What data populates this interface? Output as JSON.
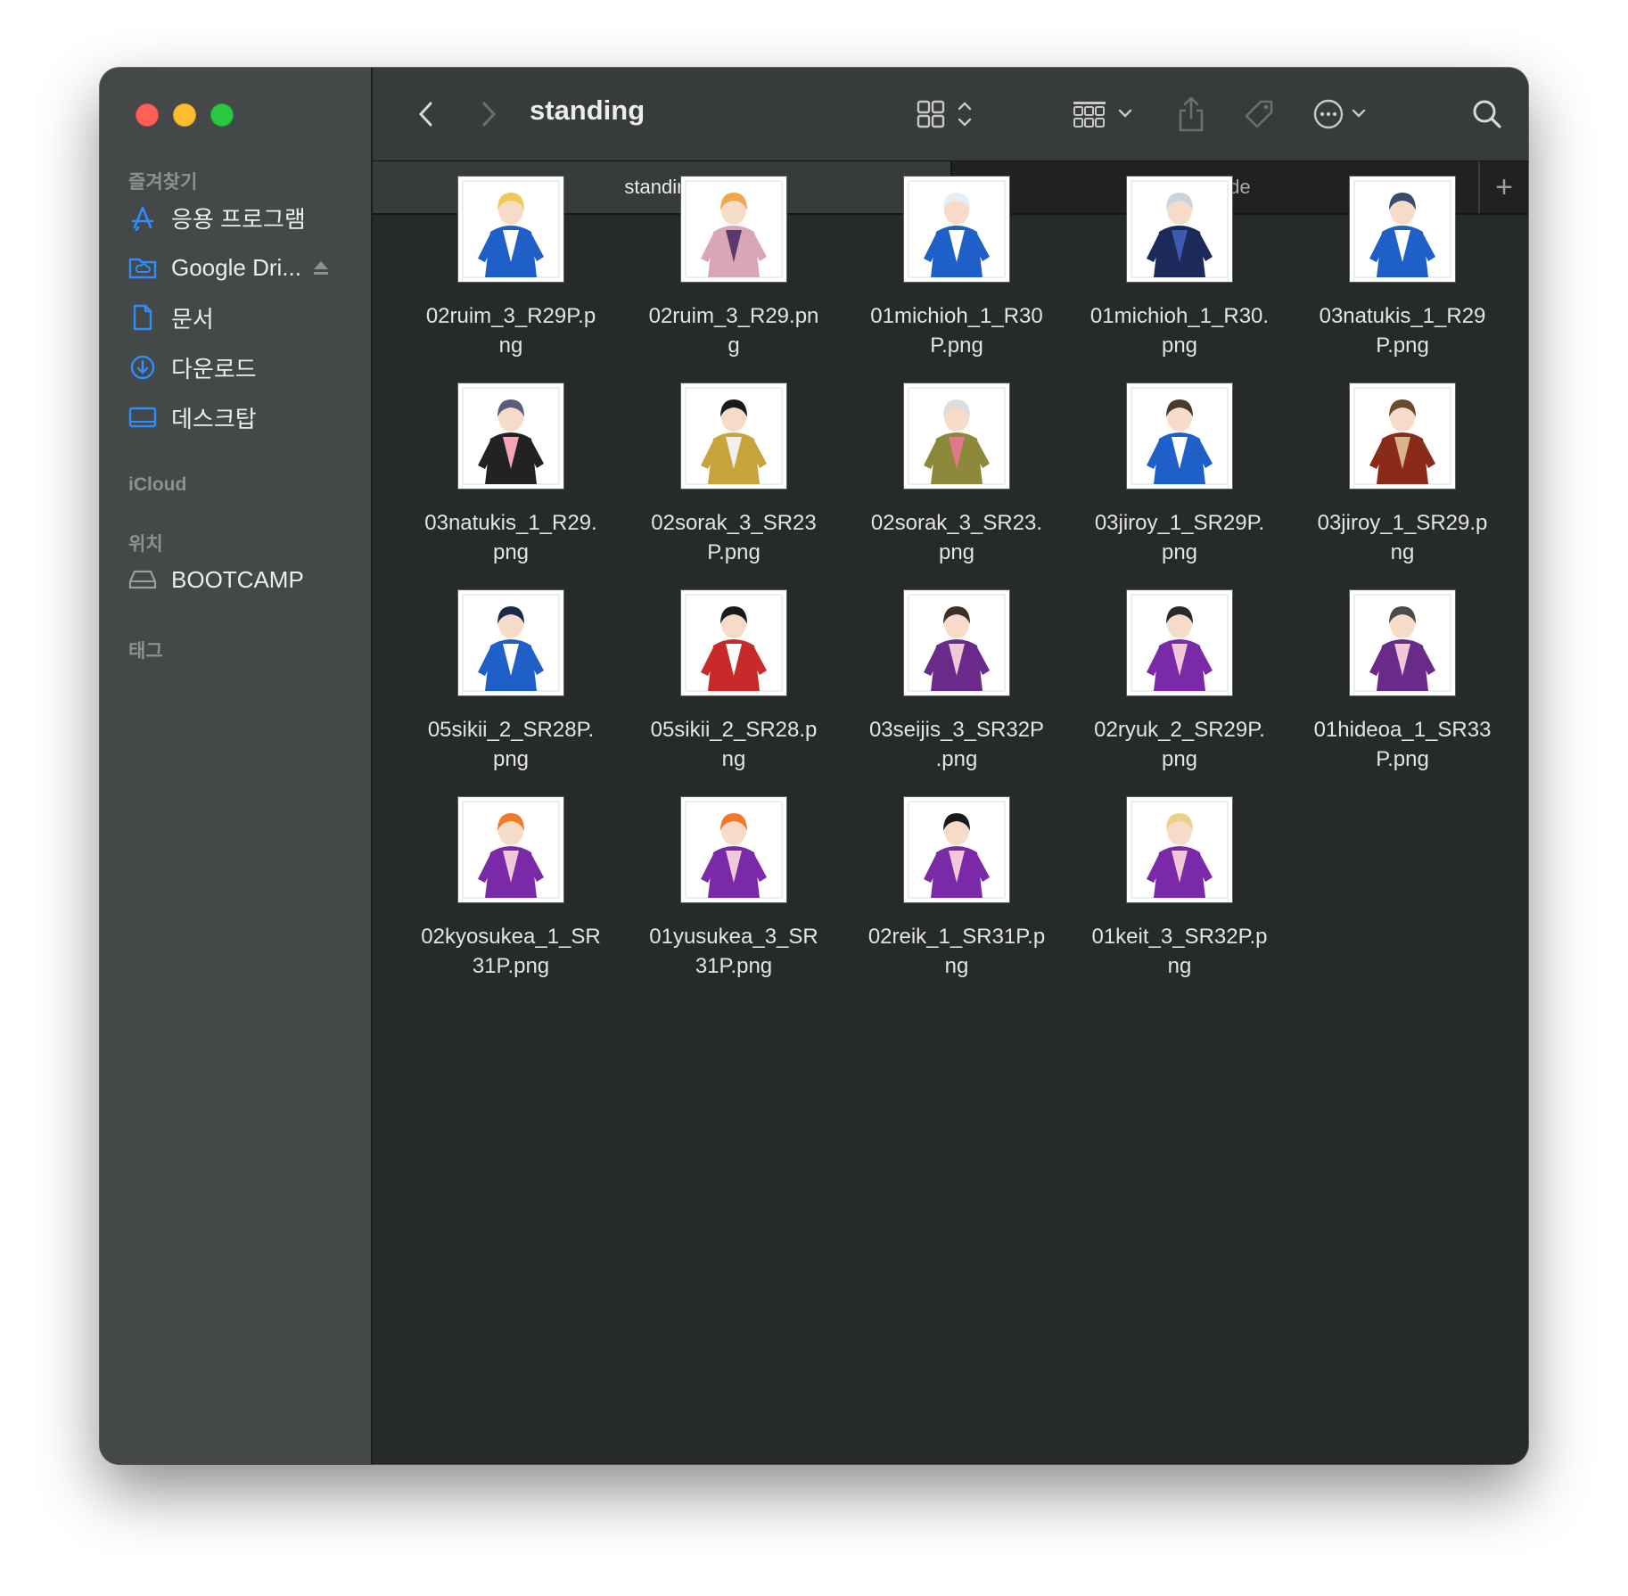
{
  "window": {
    "title": "standing",
    "tabs": [
      {
        "label": "standing",
        "active": true
      },
      {
        "label": "bromide",
        "active": false
      }
    ],
    "new_tab_label": "+"
  },
  "sidebar": {
    "sections": {
      "favorites": "즐겨찾기",
      "icloud": "iCloud",
      "locations": "위치",
      "tags": "태그"
    },
    "favorites": [
      {
        "label": "응용 프로그램",
        "icon": "applications-icon"
      },
      {
        "label": "Google Dri...",
        "icon": "cloud-folder-icon"
      },
      {
        "label": "문서",
        "icon": "document-icon"
      },
      {
        "label": "다운로드",
        "icon": "download-icon"
      },
      {
        "label": "데스크탑",
        "icon": "desktop-icon"
      }
    ],
    "locations": [
      {
        "label": "BOOTCAMP",
        "icon": "drive-icon"
      }
    ]
  },
  "colors": {
    "accent": "#2f8cff",
    "close": "#fe5f57",
    "minimize": "#febc2e",
    "zoom": "#28c840"
  },
  "files": [
    {
      "name_l1": "02ruim_3_R29P.p",
      "name_l2": "ng",
      "palette": {
        "outfit": "#1f5fc8",
        "hair": "#f2c75a",
        "accent": "#ffffff"
      }
    },
    {
      "name_l1": "02ruim_3_R29.pn",
      "name_l2": "g",
      "palette": {
        "outfit": "#d9a6b5",
        "hair": "#f1a64a",
        "accent": "#5a3a6e"
      }
    },
    {
      "name_l1": "01michioh_1_R30",
      "name_l2": "P.png",
      "palette": {
        "outfit": "#1f5fc8",
        "hair": "#e6eef5",
        "accent": "#ffffff"
      }
    },
    {
      "name_l1": "01michioh_1_R30.",
      "name_l2": "png",
      "palette": {
        "outfit": "#1b2a5a",
        "hair": "#c9d3de",
        "accent": "#3a5bb0"
      }
    },
    {
      "name_l1": "03natukis_1_R29",
      "name_l2": "P.png",
      "palette": {
        "outfit": "#1f5fc8",
        "hair": "#3a4a6a",
        "accent": "#ffffff"
      }
    },
    {
      "name_l1": "03natukis_1_R29.",
      "name_l2": "png",
      "palette": {
        "outfit": "#222222",
        "hair": "#5b5b7a",
        "accent": "#f4a6b8"
      }
    },
    {
      "name_l1": "02sorak_3_SR23",
      "name_l2": "P.png",
      "palette": {
        "outfit": "#c9a43a",
        "hair": "#1a1a1a",
        "accent": "#f0f0f0"
      }
    },
    {
      "name_l1": "02sorak_3_SR23.",
      "name_l2": "png",
      "palette": {
        "outfit": "#8c8a3a",
        "hair": "#dcdcdc",
        "accent": "#e07a8a"
      }
    },
    {
      "name_l1": "03jiroy_1_SR29P.",
      "name_l2": "png",
      "palette": {
        "outfit": "#1f5fc8",
        "hair": "#4a3a2a",
        "accent": "#ffffff"
      }
    },
    {
      "name_l1": "03jiroy_1_SR29.p",
      "name_l2": "ng",
      "palette": {
        "outfit": "#8a2a1a",
        "hair": "#6a4a2a",
        "accent": "#d8b48a"
      }
    },
    {
      "name_l1": "05sikii_2_SR28P.",
      "name_l2": "png",
      "palette": {
        "outfit": "#1f5fc8",
        "hair": "#1a2a4a",
        "accent": "#ffffff"
      }
    },
    {
      "name_l1": "05sikii_2_SR28.p",
      "name_l2": "ng",
      "palette": {
        "outfit": "#c82a2a",
        "hair": "#1a1a1a",
        "accent": "#ffffff"
      }
    },
    {
      "name_l1": "03seijis_3_SR32P",
      "name_l2": ".png",
      "palette": {
        "outfit": "#6a2a8a",
        "hair": "#3a3028",
        "accent": "#f0c8d8"
      }
    },
    {
      "name_l1": "02ryuk_2_SR29P.",
      "name_l2": "png",
      "palette": {
        "outfit": "#7a2aa8",
        "hair": "#2a2a2a",
        "accent": "#f0c8d8"
      }
    },
    {
      "name_l1": "01hideoa_1_SR33",
      "name_l2": "P.png",
      "palette": {
        "outfit": "#6a2a8a",
        "hair": "#4a4a4a",
        "accent": "#f0c8d8"
      }
    },
    {
      "name_l1": "02kyosukea_1_SR",
      "name_l2": "31P.png",
      "palette": {
        "outfit": "#7a2aa8",
        "hair": "#f07a2a",
        "accent": "#f0c8d8"
      }
    },
    {
      "name_l1": "01yusukea_3_SR",
      "name_l2": "31P.png",
      "palette": {
        "outfit": "#7a2aa8",
        "hair": "#f07a2a",
        "accent": "#f0c8d8"
      }
    },
    {
      "name_l1": "02reik_1_SR31P.p",
      "name_l2": "ng",
      "palette": {
        "outfit": "#7a2aa8",
        "hair": "#1a1a1a",
        "accent": "#f0c8d8"
      }
    },
    {
      "name_l1": "01keit_3_SR32P.p",
      "name_l2": "ng",
      "palette": {
        "outfit": "#7a2aa8",
        "hair": "#e8d28a",
        "accent": "#f0c8d8"
      }
    }
  ]
}
